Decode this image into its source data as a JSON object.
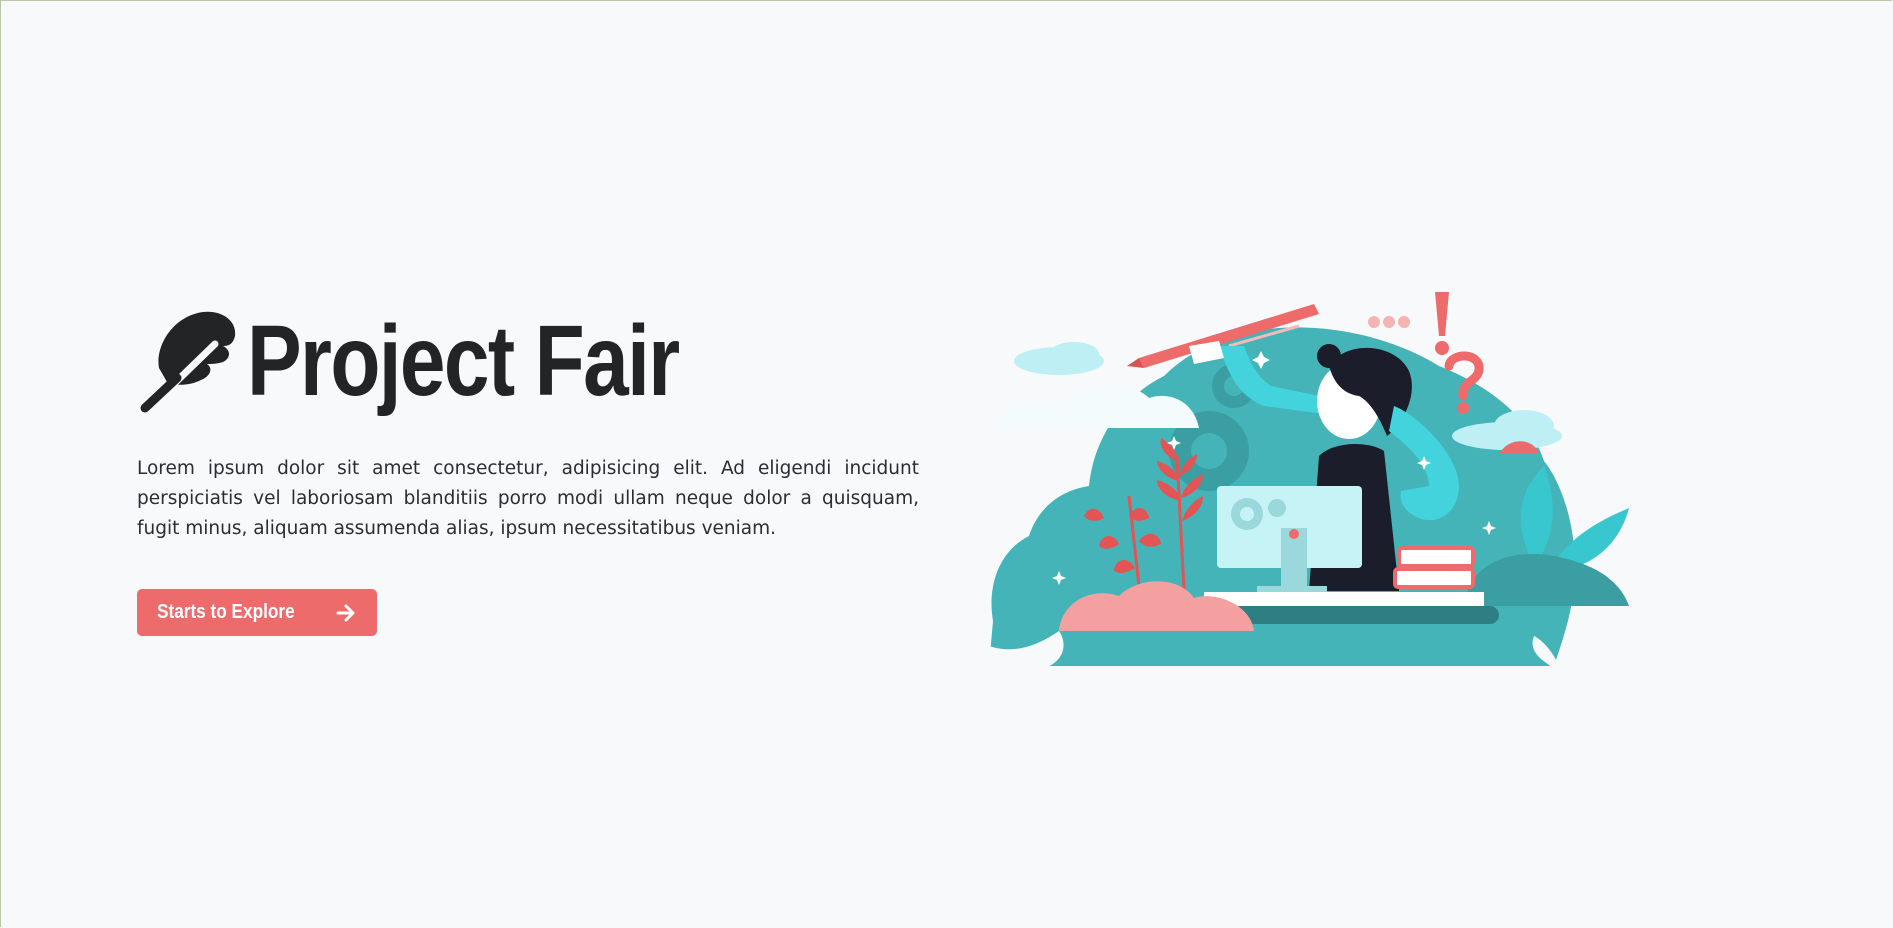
{
  "hero": {
    "title": "Project Fair",
    "description": "Lorem ipsum dolor sit amet consectetur, adipisicing elit. Ad eligendi incidunt perspiciatis vel laboriosam blanditiis porro modi ullam neque dolor a quisquam, fugit minus, aliquam assumenda alias, ipsum necessitatibus veniam.",
    "cta_label": "Starts to Explore",
    "cta_icon": "arrow-right-icon",
    "brand_icon": "feather-icon",
    "illustration": "person-at-desk-illustration"
  },
  "colors": {
    "background": "#f8f9fb",
    "title": "#222426",
    "accent": "#ee6b6b",
    "teal": "#45b4b8",
    "light_cyan": "#bdeff4"
  }
}
